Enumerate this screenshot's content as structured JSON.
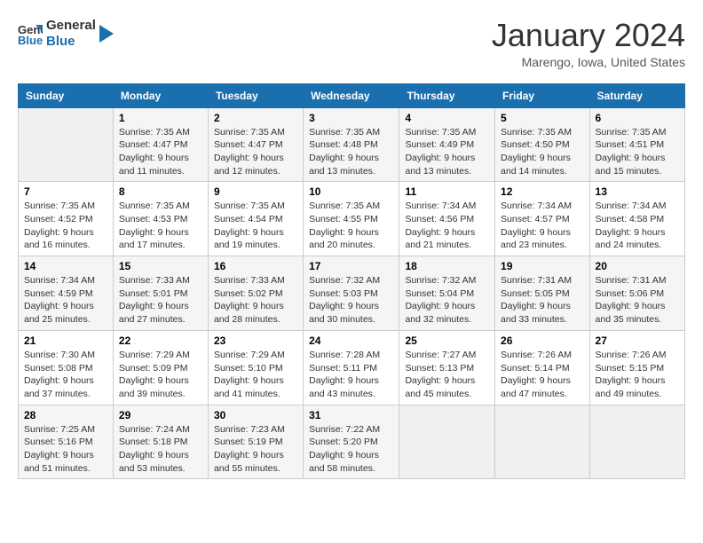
{
  "logo": {
    "line1": "General",
    "line2": "Blue"
  },
  "title": "January 2024",
  "subtitle": "Marengo, Iowa, United States",
  "days_of_week": [
    "Sunday",
    "Monday",
    "Tuesday",
    "Wednesday",
    "Thursday",
    "Friday",
    "Saturday"
  ],
  "weeks": [
    [
      {
        "day": "",
        "info": ""
      },
      {
        "day": "1",
        "info": "Sunrise: 7:35 AM\nSunset: 4:47 PM\nDaylight: 9 hours\nand 11 minutes."
      },
      {
        "day": "2",
        "info": "Sunrise: 7:35 AM\nSunset: 4:47 PM\nDaylight: 9 hours\nand 12 minutes."
      },
      {
        "day": "3",
        "info": "Sunrise: 7:35 AM\nSunset: 4:48 PM\nDaylight: 9 hours\nand 13 minutes."
      },
      {
        "day": "4",
        "info": "Sunrise: 7:35 AM\nSunset: 4:49 PM\nDaylight: 9 hours\nand 13 minutes."
      },
      {
        "day": "5",
        "info": "Sunrise: 7:35 AM\nSunset: 4:50 PM\nDaylight: 9 hours\nand 14 minutes."
      },
      {
        "day": "6",
        "info": "Sunrise: 7:35 AM\nSunset: 4:51 PM\nDaylight: 9 hours\nand 15 minutes."
      }
    ],
    [
      {
        "day": "7",
        "info": "Sunrise: 7:35 AM\nSunset: 4:52 PM\nDaylight: 9 hours\nand 16 minutes."
      },
      {
        "day": "8",
        "info": "Sunrise: 7:35 AM\nSunset: 4:53 PM\nDaylight: 9 hours\nand 17 minutes."
      },
      {
        "day": "9",
        "info": "Sunrise: 7:35 AM\nSunset: 4:54 PM\nDaylight: 9 hours\nand 19 minutes."
      },
      {
        "day": "10",
        "info": "Sunrise: 7:35 AM\nSunset: 4:55 PM\nDaylight: 9 hours\nand 20 minutes."
      },
      {
        "day": "11",
        "info": "Sunrise: 7:34 AM\nSunset: 4:56 PM\nDaylight: 9 hours\nand 21 minutes."
      },
      {
        "day": "12",
        "info": "Sunrise: 7:34 AM\nSunset: 4:57 PM\nDaylight: 9 hours\nand 23 minutes."
      },
      {
        "day": "13",
        "info": "Sunrise: 7:34 AM\nSunset: 4:58 PM\nDaylight: 9 hours\nand 24 minutes."
      }
    ],
    [
      {
        "day": "14",
        "info": "Sunrise: 7:34 AM\nSunset: 4:59 PM\nDaylight: 9 hours\nand 25 minutes."
      },
      {
        "day": "15",
        "info": "Sunrise: 7:33 AM\nSunset: 5:01 PM\nDaylight: 9 hours\nand 27 minutes."
      },
      {
        "day": "16",
        "info": "Sunrise: 7:33 AM\nSunset: 5:02 PM\nDaylight: 9 hours\nand 28 minutes."
      },
      {
        "day": "17",
        "info": "Sunrise: 7:32 AM\nSunset: 5:03 PM\nDaylight: 9 hours\nand 30 minutes."
      },
      {
        "day": "18",
        "info": "Sunrise: 7:32 AM\nSunset: 5:04 PM\nDaylight: 9 hours\nand 32 minutes."
      },
      {
        "day": "19",
        "info": "Sunrise: 7:31 AM\nSunset: 5:05 PM\nDaylight: 9 hours\nand 33 minutes."
      },
      {
        "day": "20",
        "info": "Sunrise: 7:31 AM\nSunset: 5:06 PM\nDaylight: 9 hours\nand 35 minutes."
      }
    ],
    [
      {
        "day": "21",
        "info": "Sunrise: 7:30 AM\nSunset: 5:08 PM\nDaylight: 9 hours\nand 37 minutes."
      },
      {
        "day": "22",
        "info": "Sunrise: 7:29 AM\nSunset: 5:09 PM\nDaylight: 9 hours\nand 39 minutes."
      },
      {
        "day": "23",
        "info": "Sunrise: 7:29 AM\nSunset: 5:10 PM\nDaylight: 9 hours\nand 41 minutes."
      },
      {
        "day": "24",
        "info": "Sunrise: 7:28 AM\nSunset: 5:11 PM\nDaylight: 9 hours\nand 43 minutes."
      },
      {
        "day": "25",
        "info": "Sunrise: 7:27 AM\nSunset: 5:13 PM\nDaylight: 9 hours\nand 45 minutes."
      },
      {
        "day": "26",
        "info": "Sunrise: 7:26 AM\nSunset: 5:14 PM\nDaylight: 9 hours\nand 47 minutes."
      },
      {
        "day": "27",
        "info": "Sunrise: 7:26 AM\nSunset: 5:15 PM\nDaylight: 9 hours\nand 49 minutes."
      }
    ],
    [
      {
        "day": "28",
        "info": "Sunrise: 7:25 AM\nSunset: 5:16 PM\nDaylight: 9 hours\nand 51 minutes."
      },
      {
        "day": "29",
        "info": "Sunrise: 7:24 AM\nSunset: 5:18 PM\nDaylight: 9 hours\nand 53 minutes."
      },
      {
        "day": "30",
        "info": "Sunrise: 7:23 AM\nSunset: 5:19 PM\nDaylight: 9 hours\nand 55 minutes."
      },
      {
        "day": "31",
        "info": "Sunrise: 7:22 AM\nSunset: 5:20 PM\nDaylight: 9 hours\nand 58 minutes."
      },
      {
        "day": "",
        "info": ""
      },
      {
        "day": "",
        "info": ""
      },
      {
        "day": "",
        "info": ""
      }
    ]
  ]
}
